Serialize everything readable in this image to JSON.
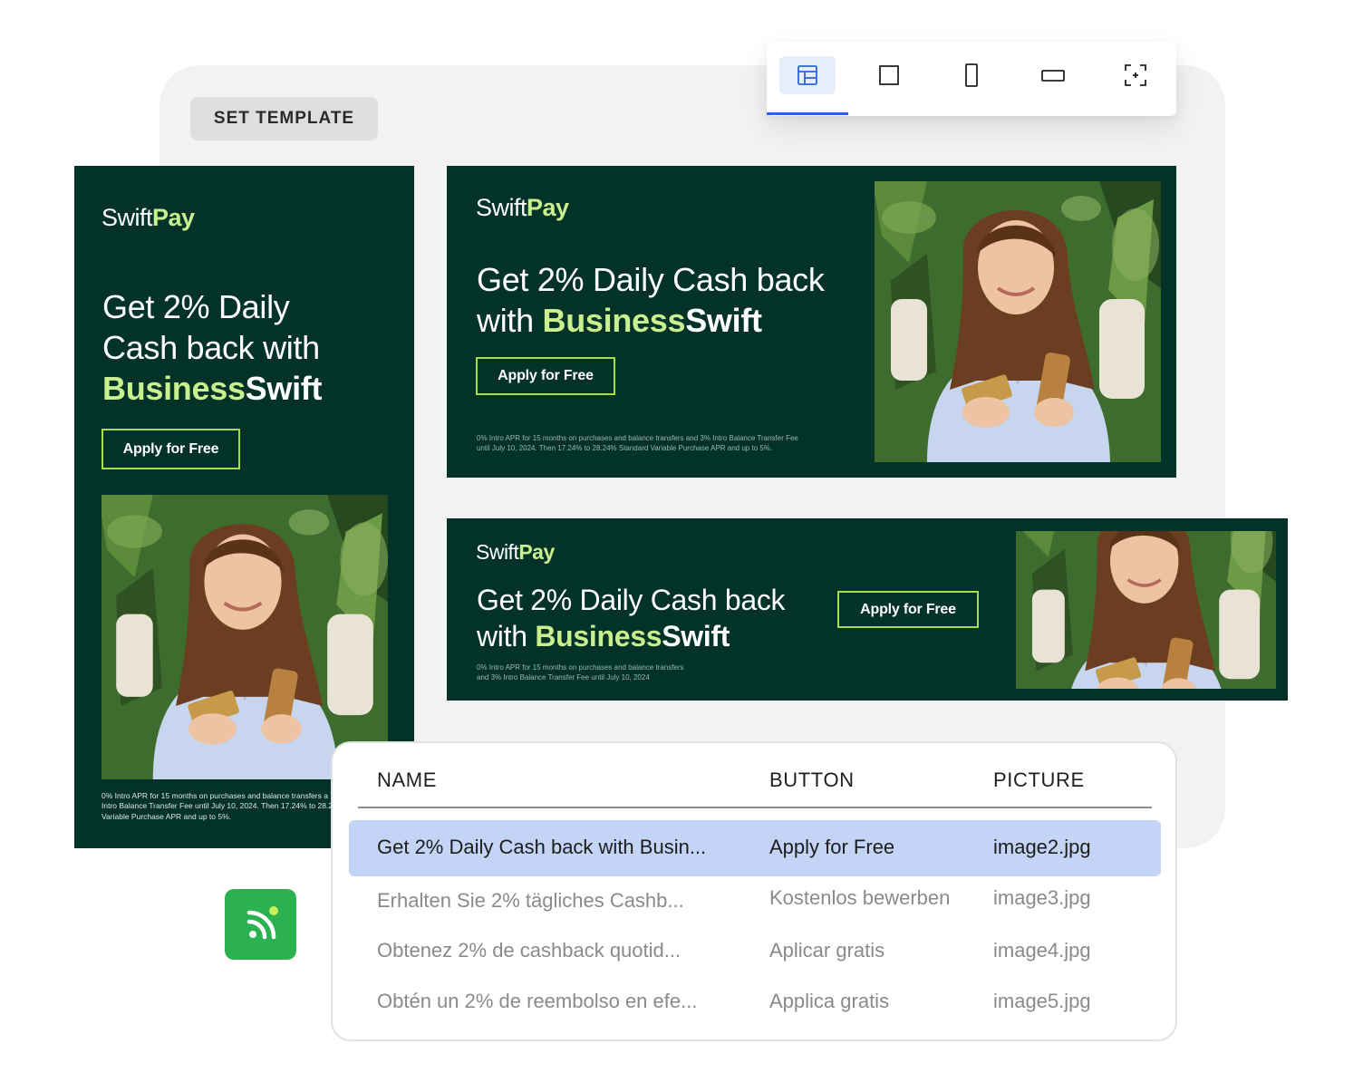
{
  "toolbar": {
    "set_template_label": "SET TEMPLATE",
    "tools": [
      "layout-icon",
      "square-format-icon",
      "portrait-format-icon",
      "landscape-format-icon",
      "focus-crop-icon"
    ],
    "active_tool": "layout-icon",
    "accent_color": "#2b64d9"
  },
  "brand": {
    "swift": "Swift",
    "pay": "Pay"
  },
  "ad": {
    "headline_prefix": "Get 2% Daily Cash back with",
    "headline_line1_vertical": "Get 2% Daily",
    "headline_line2_vertical": "Cash back with",
    "headline_line1_wide": "Get 2% Daily Cash back",
    "headline_line2_wide_prefix": "with",
    "brand_business": "Business",
    "brand_swift": "Swift",
    "cta": "Apply for Free",
    "disclaimer_vertical_1": "0% Intro APR for 15 months on purchases and balance transfers a",
    "disclaimer_vertical_2": "Intro Balance Transfer Fee until July 10, 2024. Then 17.24% to 28.2",
    "disclaimer_vertical_3": "Variable Purchase APR and up to 5%.",
    "disclaimer_medium_1": "0% Intro APR for 15 months on purchases and balance transfers and 3% Intro Balance Transfer Fee",
    "disclaimer_medium_2": "until July 10, 2024. Then 17.24% to 28.24% Standard Variable Purchase APR and up to 5%.",
    "disclaimer_banner_1": "0% Intro APR for 15 months on purchases and balance transfers",
    "disclaimer_banner_2": "and 3% Intro Balance Transfer Fee until July 10, 2024",
    "colors": {
      "background": "#023228",
      "accent": "#c9ef8f",
      "button_border": "#a7dd4a"
    }
  },
  "table": {
    "headers": {
      "name": "NAME",
      "button": "BUTTON",
      "picture": "PICTURE"
    },
    "rows": [
      {
        "name": "Get 2% Daily Cash back with Busin...",
        "button": "Apply for Free",
        "picture": "image2.jpg",
        "selected": true
      },
      {
        "name": "Erhalten Sie 2% tägliches Cashb...",
        "button": "Kostenlos bewerben",
        "picture": "image3.jpg",
        "selected": false
      },
      {
        "name": "Obtenez 2% de cashback quotid...",
        "button": "Aplicar gratis",
        "picture": "image4.jpg",
        "selected": false
      },
      {
        "name": "Obtén un 2% de reembolso en efe...",
        "button": "Applica gratis",
        "picture": "image5.jpg",
        "selected": false
      }
    ],
    "selected_color": "#c3d4f7"
  },
  "feed_icon": {
    "name": "rss-feed-icon",
    "color": "#2cb150"
  }
}
